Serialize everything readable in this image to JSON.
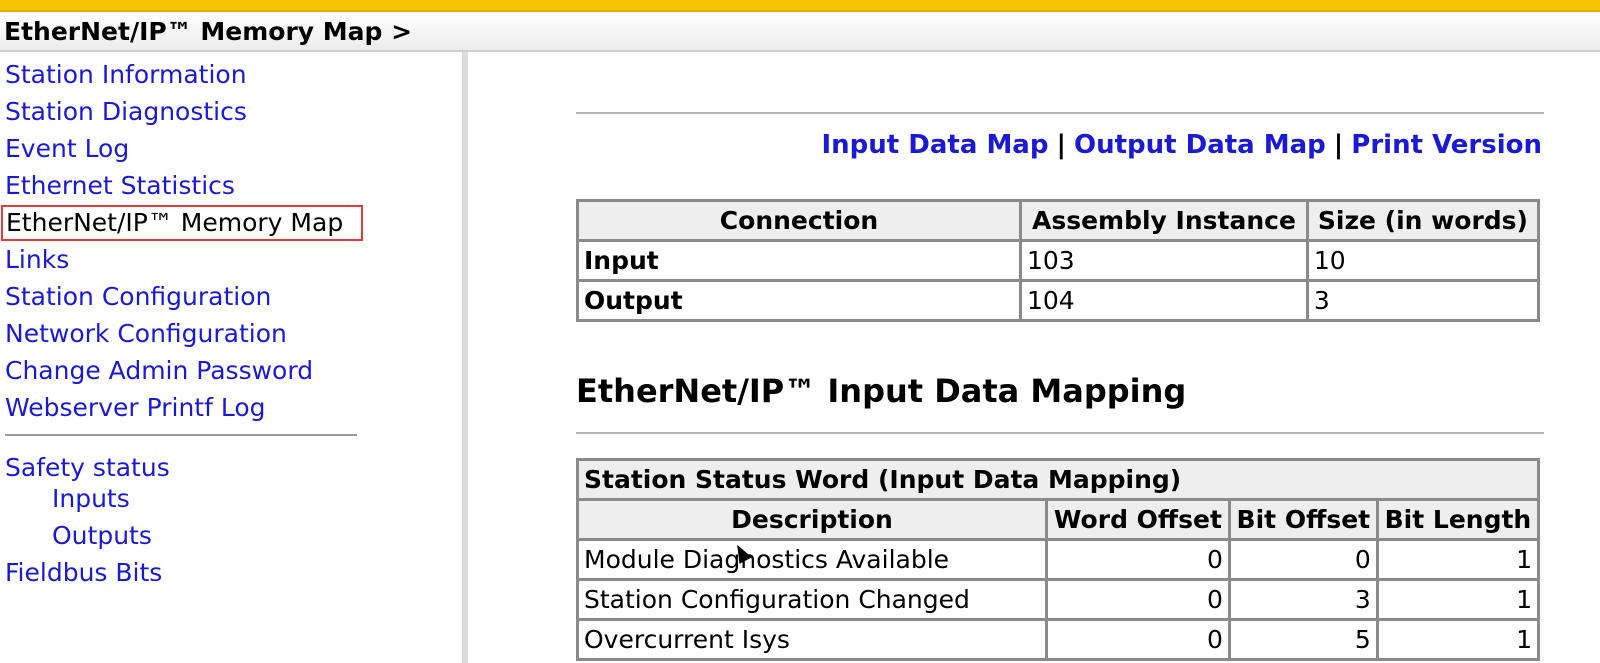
{
  "header": {
    "breadcrumb": "EtherNet/IP™ Memory Map >"
  },
  "sidebar": {
    "items": [
      {
        "label": "Station Information"
      },
      {
        "label": "Station Diagnostics"
      },
      {
        "label": "Event Log"
      },
      {
        "label": "Ethernet Statistics"
      },
      {
        "label": "EtherNet/IP™ Memory Map"
      },
      {
        "label": "Links"
      },
      {
        "label": "Station Configuration"
      },
      {
        "label": "Network Configuration"
      },
      {
        "label": "Change Admin Password"
      },
      {
        "label": "Webserver Printf Log"
      }
    ],
    "safety": {
      "label": "Safety status",
      "inputs": "Inputs",
      "outputs": "Outputs"
    },
    "fieldbus": "Fieldbus Bits"
  },
  "main": {
    "links": {
      "input": "Input Data Map",
      "output": "Output Data Map",
      "print": "Print Version",
      "sep": "|"
    },
    "connections": {
      "headers": [
        "Connection",
        "Assembly Instance",
        "Size (in words)"
      ],
      "rows": [
        {
          "name": "Input",
          "instance": "103",
          "size": "10"
        },
        {
          "name": "Output",
          "instance": "104",
          "size": "3"
        }
      ]
    },
    "section_title": "EtherNet/IP™ Input Data Mapping",
    "status_table": {
      "caption": "Station Status Word (Input Data Mapping)",
      "headers": [
        "Description",
        "Word Offset",
        "Bit Offset",
        "Bit Length"
      ],
      "rows": [
        {
          "desc": "Module Diagnostics Available",
          "word": "0",
          "bit": "0",
          "len": "1"
        },
        {
          "desc": "Station Configuration Changed",
          "word": "0",
          "bit": "3",
          "len": "1"
        },
        {
          "desc": "Overcurrent Isys",
          "word": "0",
          "bit": "5",
          "len": "1"
        }
      ]
    }
  }
}
